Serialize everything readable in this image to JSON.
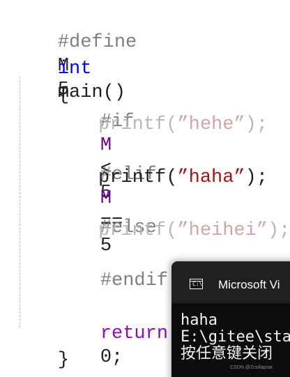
{
  "editor": {
    "define_directive": "#define",
    "define_macro": "M",
    "define_value": "5",
    "main_type": "int",
    "main_signature": "main()",
    "open_brace": "{",
    "if_directive": "#if",
    "if_macro": "M",
    "if_operator": "<",
    "if_value": "5",
    "printf_hehe_func": "printf(",
    "printf_hehe_string": "”hehe”",
    "printf_hehe_end": ");",
    "elif_directive": "#elif",
    "elif_macro": "M",
    "elif_operator": "==",
    "elif_value": "5",
    "printf_haha_func": "printf(",
    "printf_haha_string": "”haha”",
    "printf_haha_end": ");",
    "else_directive": "#else",
    "printf_heihei_func": "printf(",
    "printf_heihei_string": "”heihei”",
    "printf_heihei_end": ");",
    "endif_directive": "#endif",
    "return_keyword": "return",
    "return_value": "0;",
    "close_brace": "}"
  },
  "console": {
    "icon": "console-window-icon",
    "icon_label": "C:\\",
    "title": "Microsoft Vi",
    "lines": [
      "haha",
      "E:\\gitee\\sta",
      "按任意键关闭"
    ]
  },
  "watermark": {
    "text": "CSDN @Zcollapsar."
  }
}
